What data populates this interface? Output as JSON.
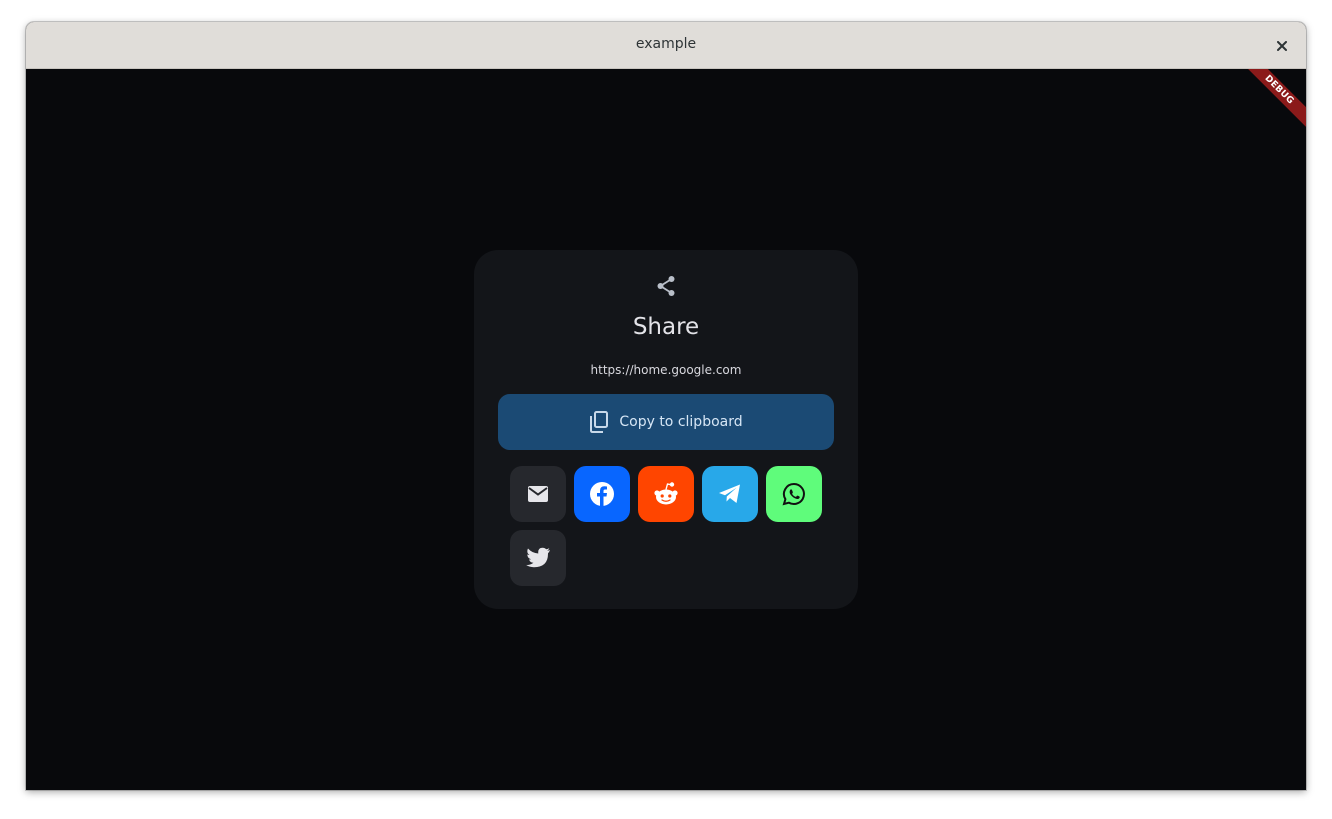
{
  "window": {
    "title": "example",
    "close_icon": "close-icon"
  },
  "debug_banner": {
    "label": "DEBUG",
    "color": "#8b1a1a"
  },
  "share_card": {
    "icon": "share-icon",
    "title": "Share",
    "url": "https://home.google.com",
    "copy_button": {
      "icon": "copy-icon",
      "label": "Copy to clipboard",
      "color": "#1b4a74"
    },
    "social_buttons": [
      {
        "name": "email",
        "icon": "email-icon",
        "color": "#26282d"
      },
      {
        "name": "facebook",
        "icon": "facebook-icon",
        "color": "#0866ff"
      },
      {
        "name": "reddit",
        "icon": "reddit-icon",
        "color": "#ff4500"
      },
      {
        "name": "telegram",
        "icon": "telegram-icon",
        "color": "#28a8e9"
      },
      {
        "name": "whatsapp",
        "icon": "whatsapp-icon",
        "color": "#5ffc7b"
      },
      {
        "name": "twitter",
        "icon": "twitter-icon",
        "color": "#26282d"
      }
    ]
  }
}
